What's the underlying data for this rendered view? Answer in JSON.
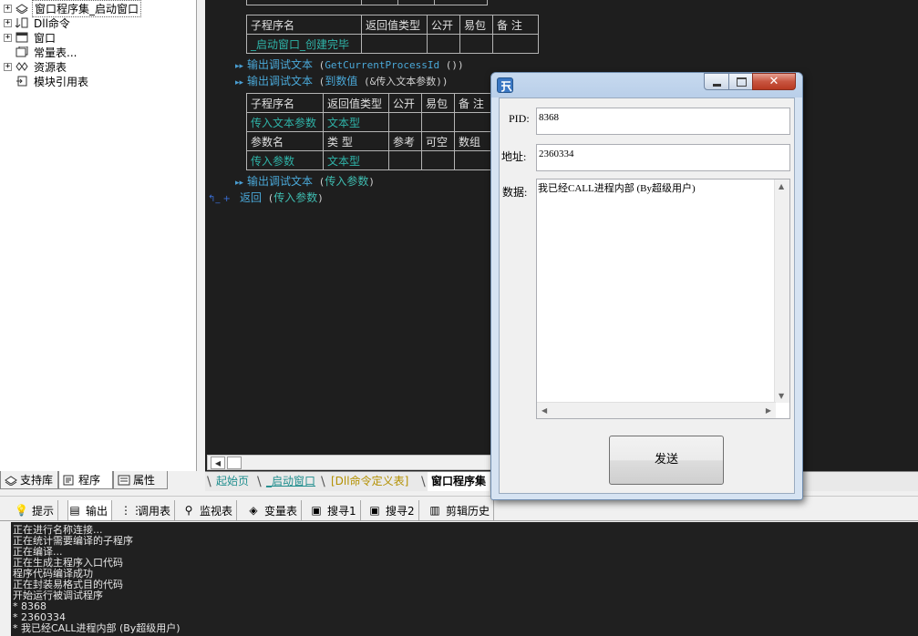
{
  "tree": {
    "items": [
      {
        "label": "窗口程序集_启动窗口",
        "expander": "+",
        "selected": true
      },
      {
        "label": "Dll命令",
        "expander": "+",
        "selected": false
      },
      {
        "label": "窗口",
        "expander": "+",
        "selected": false
      },
      {
        "label": "常量表...",
        "expander": "",
        "selected": false
      },
      {
        "label": "资源表",
        "expander": "+",
        "selected": false
      },
      {
        "label": "模块引用表",
        "expander": "",
        "selected": false
      }
    ]
  },
  "left_tabs": [
    {
      "label": "支持库"
    },
    {
      "label": "程序"
    },
    {
      "label": "属性"
    }
  ],
  "editor": {
    "sub1": {
      "headers": [
        "子程序名",
        "返回值类型",
        "公开",
        "易包",
        "备 注"
      ],
      "name": "_启动窗口_创建完毕"
    },
    "line1": {
      "fn": "输出调试文本",
      "open": " (",
      "inner": "GetCurrentProcessId",
      "close": " ())"
    },
    "line2": {
      "fn": "输出调试文本",
      "open": " (",
      "inner": "到数值",
      "arg": " (&传入文本参数))"
    },
    "sub2": {
      "headers": [
        "子程序名",
        "返回值类型",
        "公开",
        "易包",
        "备 注"
      ],
      "name": "传入文本参数",
      "type": "文本型",
      "param_headers": [
        "参数名",
        "类 型",
        "参考",
        "可空",
        "数组"
      ],
      "param_name": "传入参数",
      "param_type": "文本型"
    },
    "line3": {
      "fn": "输出调试文本",
      "open": " (",
      "arg": "传入参数",
      "close": ")"
    },
    "line4": {
      "fn": "返回",
      "open": " (",
      "arg": "传入参数",
      "close": ")"
    }
  },
  "editor_tabs": [
    {
      "label": "起始页"
    },
    {
      "label": "_启动窗口"
    },
    {
      "label": "[Dll命令定义表]"
    },
    {
      "label": "窗口程序集"
    }
  ],
  "output_toolbar": [
    {
      "label": "提示",
      "icon": "lightbulb-icon"
    },
    {
      "label": "输出",
      "icon": "output-icon"
    },
    {
      "label": "调用表",
      "icon": "call-table-icon"
    },
    {
      "label": "监视表",
      "icon": "magnifier-icon"
    },
    {
      "label": "变量表",
      "icon": "variable-icon"
    },
    {
      "label": "搜寻1",
      "icon": "search1-icon"
    },
    {
      "label": "搜寻2",
      "icon": "search2-icon"
    },
    {
      "label": "剪辑历史",
      "icon": "clipboard-icon"
    }
  ],
  "output_lines": [
    "正在进行名称连接...",
    "正在统计需要编译的子程序",
    "正在编译...",
    "正在生成主程序入口代码",
    "程序代码编译成功",
    "正在封装易格式目的代码",
    "开始运行被调试程序",
    "* 8368",
    "* 2360334",
    "* 我已经CALL进程内部 (By超级用户)"
  ],
  "dialog": {
    "close_glyph": "✕",
    "pid_label": "PID:",
    "pid_value": "8368",
    "address_label": "地址:",
    "address_value": "2360334",
    "data_label": "数据:",
    "data_value": "我已经CALL进程内部 (By超级用户)",
    "send_label": "发送"
  }
}
